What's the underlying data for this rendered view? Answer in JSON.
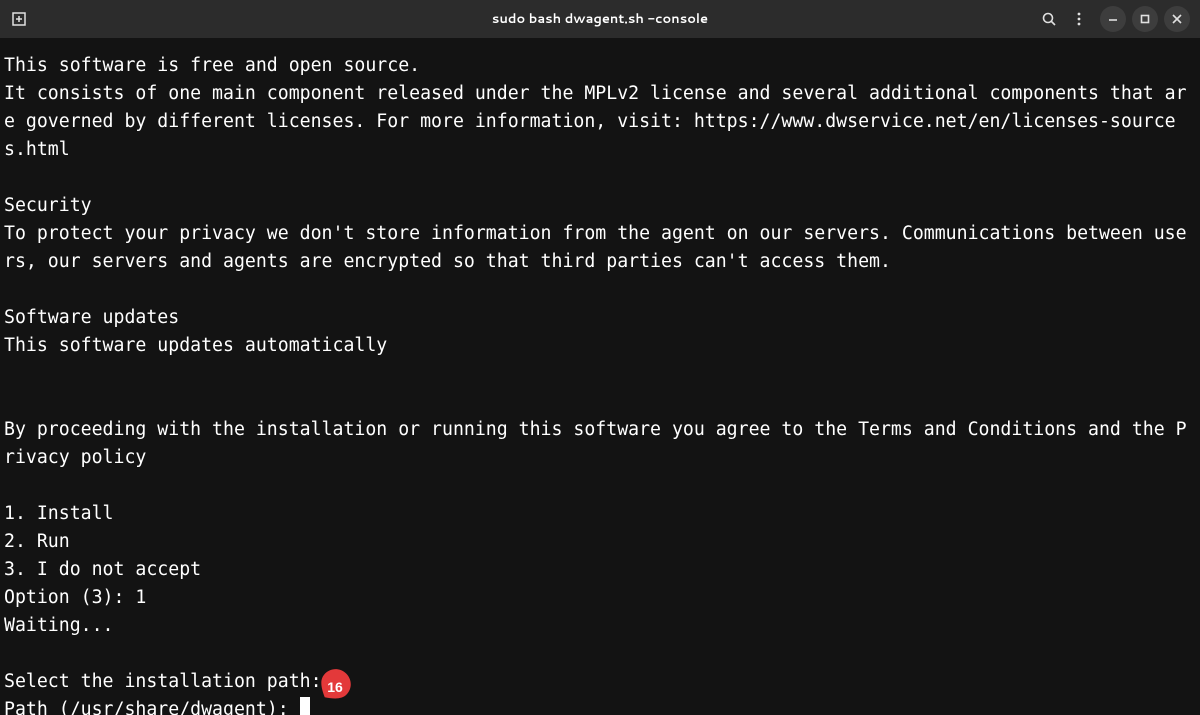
{
  "window": {
    "title": "sudo bash dwagent.sh -console"
  },
  "terminal": {
    "lines": [
      "This software is free and open source.",
      "It consists of one main component released under the MPLv2 license and several additional components that are governed by different licenses. For more information, visit: https://www.dwservice.net/en/licenses-sources.html",
      "",
      "Security",
      "To protect your privacy we don't store information from the agent on our servers. Communications between users, our servers and agents are encrypted so that third parties can't access them.",
      "",
      "Software updates",
      "This software updates automatically",
      "",
      "",
      "By proceeding with the installation or running this software you agree to the Terms and Conditions and the Privacy policy",
      "",
      "1. Install",
      "2. Run",
      "3. I do not accept",
      "Option (3): 1",
      "Waiting...",
      "",
      "Select the installation path:"
    ],
    "prompt_line": "Path (/usr/share/dwagent): "
  },
  "annotation": {
    "label": "16"
  }
}
